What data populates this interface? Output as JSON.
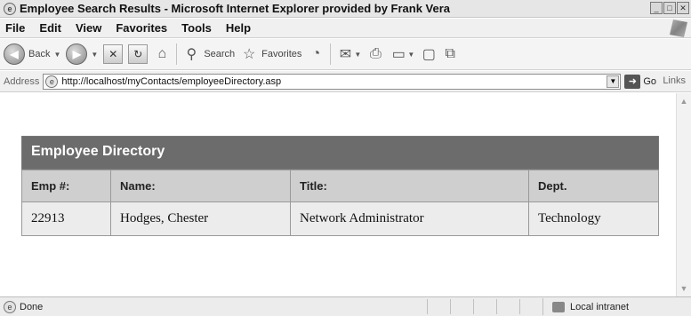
{
  "window": {
    "title": "Employee Search Results - Microsoft Internet Explorer provided by Frank Vera"
  },
  "menu": [
    {
      "label": "File"
    },
    {
      "label": "Edit"
    },
    {
      "label": "View"
    },
    {
      "label": "Favorites"
    },
    {
      "label": "Tools"
    },
    {
      "label": "Help"
    }
  ],
  "toolbar": {
    "back_label": "Back",
    "search_label": "Search",
    "favorites_label": "Favorites"
  },
  "address": {
    "label": "Address",
    "url": "http://localhost/myContacts/employeeDirectory.asp",
    "go_label": "Go",
    "links_label": "Links"
  },
  "directory": {
    "caption": "Employee Directory",
    "headers": [
      "Emp #:",
      "Name:",
      "Title:",
      "Dept."
    ],
    "rows": [
      [
        "22913",
        "Hodges, Chester",
        "Network Administrator",
        "Technology"
      ]
    ]
  },
  "status": {
    "text": "Done",
    "zone": "Local intranet"
  }
}
